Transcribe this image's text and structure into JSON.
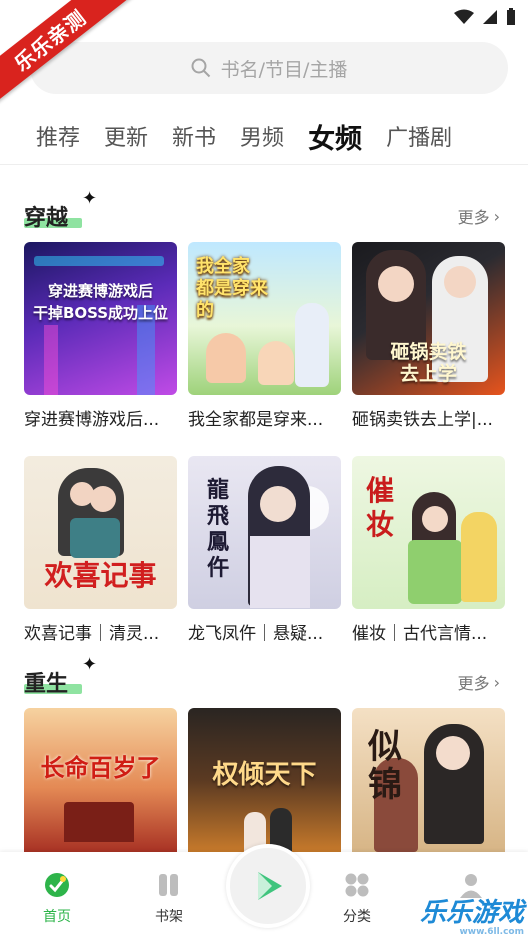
{
  "ribbon": "乐乐亲测",
  "search": {
    "placeholder": "书名/节目/主播"
  },
  "tabs": [
    "推荐",
    "更新",
    "新书",
    "男频",
    "女频",
    "广播剧"
  ],
  "sections": [
    {
      "title": "穿越",
      "more": "更多",
      "items": [
        {
          "title": "穿进赛博游戏后...",
          "cover_text": "穿进赛博游戏后\n干掉BOSS成功上位"
        },
        {
          "title": "我全家都是穿来...",
          "cover_text": "我全家\n都是穿来的"
        },
        {
          "title": "砸锅卖铁去上学|...",
          "cover_text": "砸锅卖铁\n去上学"
        },
        {
          "title": "欢喜记事｜清灵...",
          "cover_text": "欢喜记事"
        },
        {
          "title": "龙飞凤仵｜悬疑...",
          "cover_text": "龍飛鳳仵"
        },
        {
          "title": "催妆｜古代言情...",
          "cover_text": "催妆"
        }
      ]
    },
    {
      "title": "重生",
      "more": "更多",
      "items": [
        {
          "title": "",
          "cover_text": "长命百岁了"
        },
        {
          "title": "",
          "cover_text": "权倾天下"
        },
        {
          "title": "",
          "cover_text": "似锦"
        }
      ]
    }
  ],
  "nav": {
    "home": "首页",
    "shelf": "书架",
    "category": "分类"
  },
  "watermark": {
    "main": "乐乐游戏",
    "sub": "www.6ll.com"
  },
  "colors": {
    "accent": "#2eb44a",
    "ribbon": "#d9231e",
    "highlight": "#8fe3a1"
  }
}
